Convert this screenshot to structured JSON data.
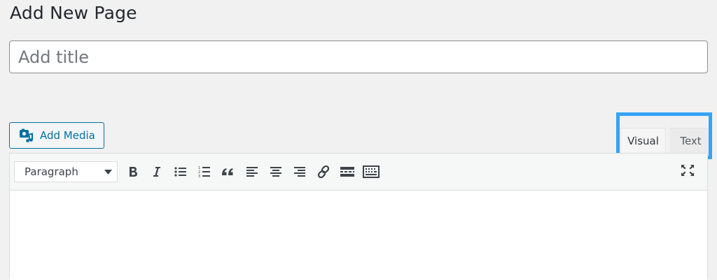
{
  "page": {
    "heading": "Add New Page"
  },
  "title_field": {
    "placeholder": "Add title",
    "value": ""
  },
  "media": {
    "add_media_label": "Add Media",
    "icon": "media-camera-music-icon"
  },
  "editor_tabs": {
    "visual": "Visual",
    "text": "Text",
    "active": "visual"
  },
  "toolbar": {
    "format_select": "Paragraph",
    "buttons": [
      {
        "name": "bold",
        "icon": "bold-icon"
      },
      {
        "name": "italic",
        "icon": "italic-icon"
      },
      {
        "name": "bulleted-list",
        "icon": "bulleted-list-icon"
      },
      {
        "name": "numbered-list",
        "icon": "numbered-list-icon"
      },
      {
        "name": "blockquote",
        "icon": "blockquote-icon"
      },
      {
        "name": "align-left",
        "icon": "align-left-icon"
      },
      {
        "name": "align-center",
        "icon": "align-center-icon"
      },
      {
        "name": "align-right",
        "icon": "align-right-icon"
      },
      {
        "name": "insert-link",
        "icon": "link-icon"
      },
      {
        "name": "read-more",
        "icon": "read-more-icon"
      },
      {
        "name": "toolbar-toggle",
        "icon": "keyboard-icon"
      }
    ],
    "fullscreen_icon": "fullscreen-icon"
  },
  "colors": {
    "accent": "#0071a1",
    "highlight": "#36a3f7",
    "background": "#f1f1f1"
  }
}
